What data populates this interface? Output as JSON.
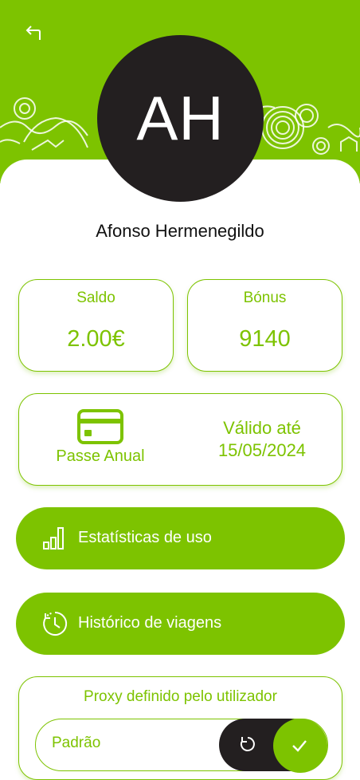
{
  "profile": {
    "initials": "AH",
    "name": "Afonso Hermenegildo"
  },
  "balance": {
    "saldo_label": "Saldo",
    "saldo_value": "2.00€",
    "bonus_label": "Bónus",
    "bonus_value": "9140"
  },
  "pass": {
    "name": "Passe Anual",
    "valid_label": "Válido até",
    "valid_date": "15/05/2024"
  },
  "actions": {
    "stats_label": "Estatísticas de uso",
    "history_label": "Histórico de viagens"
  },
  "proxy": {
    "title": "Proxy definido pelo utilizador",
    "placeholder": "Padrão"
  },
  "icons": {
    "back": "back-arrow-icon",
    "card": "credit-card-icon",
    "stats": "bar-chart-icon",
    "history": "clock-history-icon",
    "reset": "refresh-icon",
    "confirm": "check-icon"
  },
  "colors": {
    "brand_green": "#7dc300",
    "dark": "#231f20",
    "white": "#ffffff"
  }
}
